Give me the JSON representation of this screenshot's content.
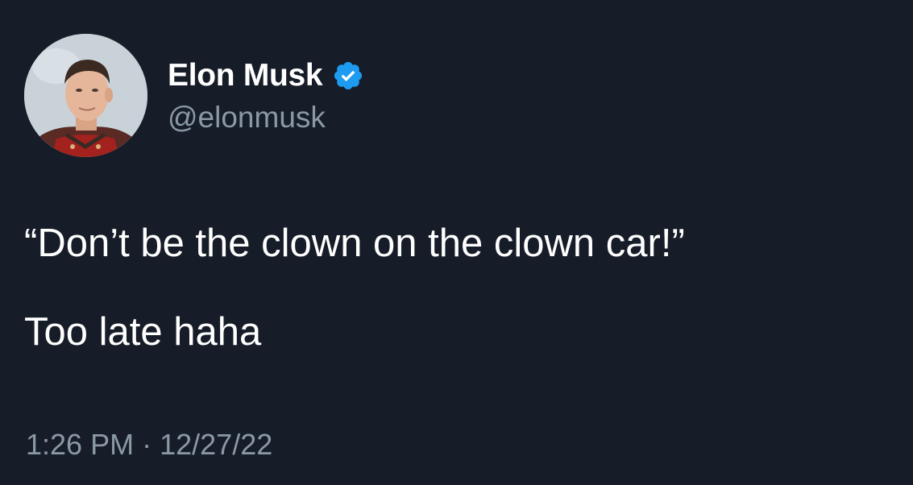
{
  "author": {
    "display_name": "Elon Musk",
    "handle": "@elonmusk",
    "verified": true,
    "verified_icon": "verified-badge-icon",
    "verified_color": "#1d9bf0"
  },
  "tweet": {
    "lines": [
      "“Don’t be the clown on the clown car!”",
      "Too late haha"
    ]
  },
  "meta": {
    "time": "1:26 PM",
    "separator": "·",
    "date": "12/27/22"
  },
  "colors": {
    "background": "#161d28",
    "primary_text": "#ffffff",
    "secondary_text": "#8b98a5"
  }
}
